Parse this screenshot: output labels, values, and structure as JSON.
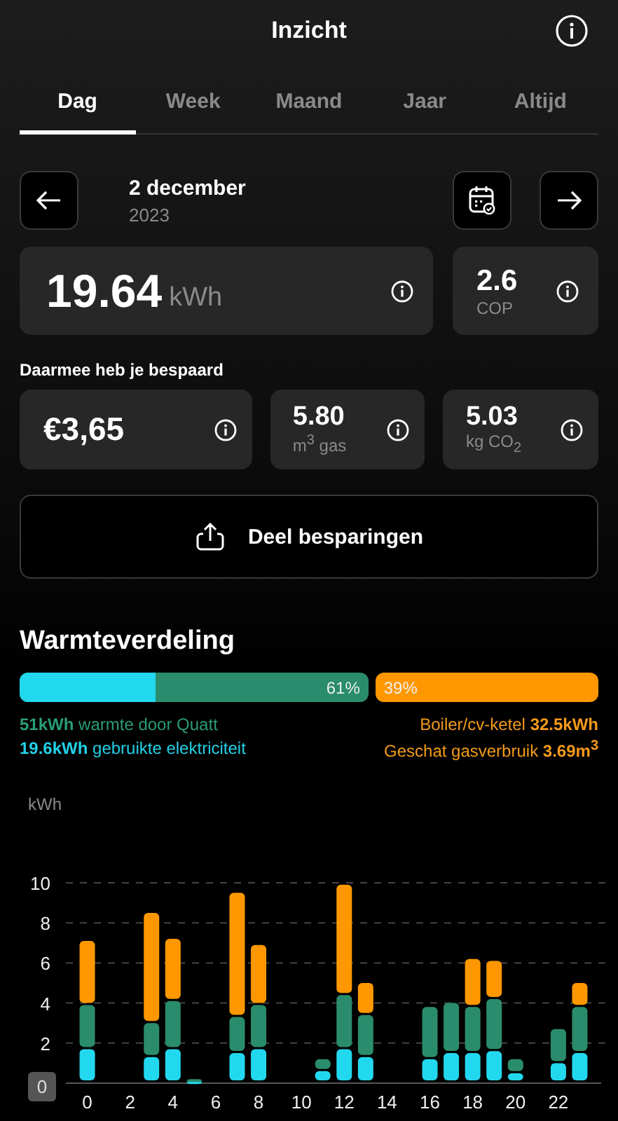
{
  "header": {
    "title": "Inzicht"
  },
  "tabs": [
    {
      "label": "Dag",
      "selected": true
    },
    {
      "label": "Week",
      "selected": false
    },
    {
      "label": "Maand",
      "selected": false
    },
    {
      "label": "Jaar",
      "selected": false
    },
    {
      "label": "Altijd",
      "selected": false
    }
  ],
  "date": {
    "day": "2 december",
    "year": "2023"
  },
  "usage": {
    "value": "19.64",
    "unit": "kWh"
  },
  "cop": {
    "value": "2.6",
    "unit": "COP"
  },
  "savings": {
    "title": "Daarmee heb je bespaard",
    "items": [
      {
        "value": "€3,65"
      },
      {
        "value": "5.80",
        "unit": "m$^{3}$ gas"
      },
      {
        "value": "5.03",
        "unit": "kg CO$_{2}$"
      }
    ]
  },
  "share_button": {
    "label": "Deel besparingen"
  },
  "heat_distribution": {
    "title": "Warmteverdeling",
    "quatt": {
      "label": "61%"
    },
    "electricity": {
      "level": 0.39
    },
    "boiler": {
      "label": "39%"
    },
    "legend": [
      {
        "kind": "quatt",
        "text": "**51kWh** warmte door Quatt"
      },
      {
        "kind": "boiler",
        "text": "Boiler/cv-ketel **32.5kWh**"
      },
      {
        "kind": "electricity",
        "text": "**19.6kWh** gebruikte elektriciteit"
      },
      {
        "kind": "gas",
        "text": "Geschat gasverbruik **3.69m$^{3}$**"
      }
    ]
  },
  "energy_chart": {
    "chart_data": {
      "type": "bar",
      "stacked": true,
      "ylabel": "kWh",
      "grid": true,
      "x": [
        0,
        1,
        2,
        3,
        4,
        5,
        6,
        7,
        8,
        9,
        10,
        11,
        12,
        13,
        14,
        15,
        16,
        17,
        18,
        19,
        20,
        21,
        22,
        23
      ],
      "series": [
        {
          "color": "#22d8ee",
          "values": [
            1.7,
            0,
            0,
            1.3,
            1.7,
            0.1,
            0,
            1.5,
            1.7,
            0,
            0,
            0.6,
            1.7,
            1.3,
            0,
            0,
            1.2,
            1.5,
            1.5,
            1.6,
            0.5,
            0,
            1.0,
            1.5
          ]
        },
        {
          "color": "#2a8c6c",
          "values": [
            2.2,
            0,
            0,
            1.7,
            2.4,
            0.1,
            0,
            1.8,
            2.2,
            0,
            0,
            0.6,
            2.7,
            2.1,
            0,
            0,
            2.6,
            2.5,
            2.3,
            2.6,
            0.7,
            0,
            1.7,
            2.3
          ]
        },
        {
          "color": "#ff9800",
          "values": [
            3.2,
            0,
            0,
            5.5,
            3.1,
            0,
            0,
            6.2,
            3.0,
            0,
            0,
            0,
            5.5,
            1.6,
            0,
            0,
            0,
            0,
            2.4,
            1.9,
            0,
            0,
            0,
            1.2
          ]
        }
      ],
      "xlim": [
        -1,
        24
      ],
      "ylim": [
        0,
        10
      ],
      "yticks": [
        0,
        2,
        4,
        6,
        8,
        10
      ],
      "xticks": [
        0,
        2,
        4,
        6,
        8,
        10,
        12,
        14,
        16,
        18,
        20,
        22
      ]
    }
  }
}
